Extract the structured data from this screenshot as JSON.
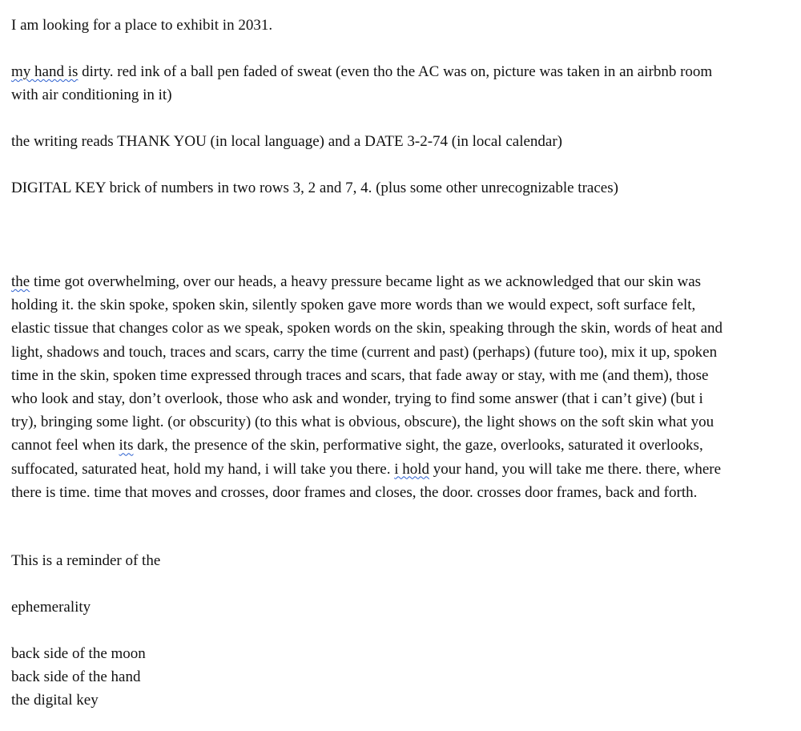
{
  "intro": {
    "line1": "I am looking for a place to exhibit in 2031.",
    "line2a_flag": "my hand is",
    "line2a_rest": " dirty. red ink of a ball pen faded of sweat (even tho the AC was on,  picture was taken in an airbnb room",
    "line2b": "with air conditioning in it)",
    "line3": "the writing reads THANK YOU (in local language) and a DATE 3-2-74 (in local calendar)",
    "line4": "DIGITAL KEY brick of numbers in two rows 3, 2 and 7, 4. (plus some other unrecognizable traces)"
  },
  "essay": {
    "l1_flag": "the",
    "l1_rest": " time got overwhelming, over our heads, a heavy pressure became light as we acknowledged that our skin was",
    "l2": "holding it. the skin spoke, spoken skin, silently spoken gave more words than we would expect, soft surface felt,",
    "l3": "elastic tissue that changes color as we speak, spoken words on the skin, speaking through the skin, words of heat and",
    "l4": "light, shadows and touch, traces and scars, carry the time (current and past) (perhaps) (future too), mix it up, spoken",
    "l5": "time in the skin, spoken time expressed through traces and scars, that fade away or stay, with me (and them), those",
    "l6": "who look and stay, don’t overlook, those who ask and wonder, trying to find some answer (that i can’t give) (but i",
    "l7": "try), bringing some light. (or obscurity) (to this what is obvious, obscure), the light shows on the soft skin what you",
    "l8_pre": "cannot feel when ",
    "l8_flag": "its",
    "l8_post": " dark, the presence of the skin, performative sight, the gaze, overlooks, saturated it overlooks,",
    "l9_pre": "suffocated, saturated heat, hold my hand, i will take you there. ",
    "l9_flag": "i hold",
    "l9_post": " your hand, you will take me there. there, where",
    "l10": "there is time. time that moves and crosses, door frames and closes, the door. crosses door frames, back and forth."
  },
  "closing": {
    "reminder": "This is a reminder of the",
    "ephemerality": "ephemerality",
    "moon": "back side of the moon",
    "hand": "back side of the hand",
    "key": "the digital key"
  },
  "colors": {
    "text": "#111111",
    "spellcheck_underline": "#2a5fd0",
    "background": "#ffffff"
  }
}
